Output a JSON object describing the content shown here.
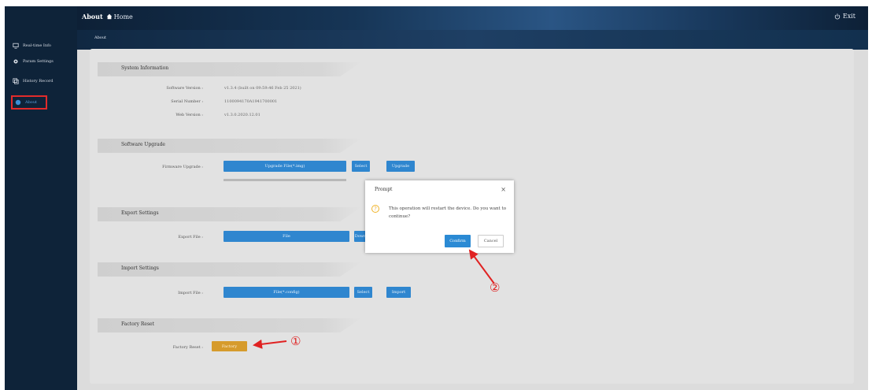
{
  "header": {
    "title": "About",
    "home_label": "Home",
    "exit_label": "Exit"
  },
  "sidebar": {
    "items": [
      {
        "label": "Real-time Info",
        "icon": "monitor-icon"
      },
      {
        "label": "Param Settings",
        "icon": "gear-icon"
      },
      {
        "label": "History Record",
        "icon": "history-icon"
      },
      {
        "label": "About",
        "icon": "info-icon",
        "active": true
      }
    ]
  },
  "tab": {
    "label": "About"
  },
  "system_info": {
    "heading": "System Information",
    "rows": [
      {
        "label": "Software Version :",
        "value": "v1.3.4 (built on 09:59:46 Feb 25 2021)"
      },
      {
        "label": "Serial Number :",
        "value": "1100094170A1941700001"
      },
      {
        "label": "Web Version :",
        "value": "v1.3.0.2020.12.01"
      }
    ]
  },
  "software_upgrade": {
    "heading": "Software Upgrade",
    "label": "Firmware Upgrade :",
    "file_box": "Upgrade File(*.img)",
    "select_label": "Select",
    "upgrade_label": "Upgrade"
  },
  "export_settings": {
    "heading": "Export Settings",
    "label": "Export File :",
    "file_box": "File",
    "download_label": "Down"
  },
  "import_settings": {
    "heading": "Import Settings",
    "label": "Import File :",
    "file_box": "File(*.config)",
    "select_label": "Select",
    "import_label": "Import"
  },
  "factory_reset": {
    "heading": "Factory Reset",
    "label": "Factory Reset :",
    "button": "Factory"
  },
  "dialog": {
    "title": "Prompt",
    "close": "×",
    "icon_glyph": "?",
    "message": "This operation will restart the device. Do you want to continue?",
    "confirm": "Confirm",
    "cancel": "Cancel"
  },
  "annotations": {
    "step1": "①",
    "step2": "②"
  },
  "colors": {
    "sidebar_bg": "#0e2339",
    "accent_blue": "#2f86cf",
    "reset_orange": "#d69b2c",
    "annotation_red": "#e02222"
  }
}
